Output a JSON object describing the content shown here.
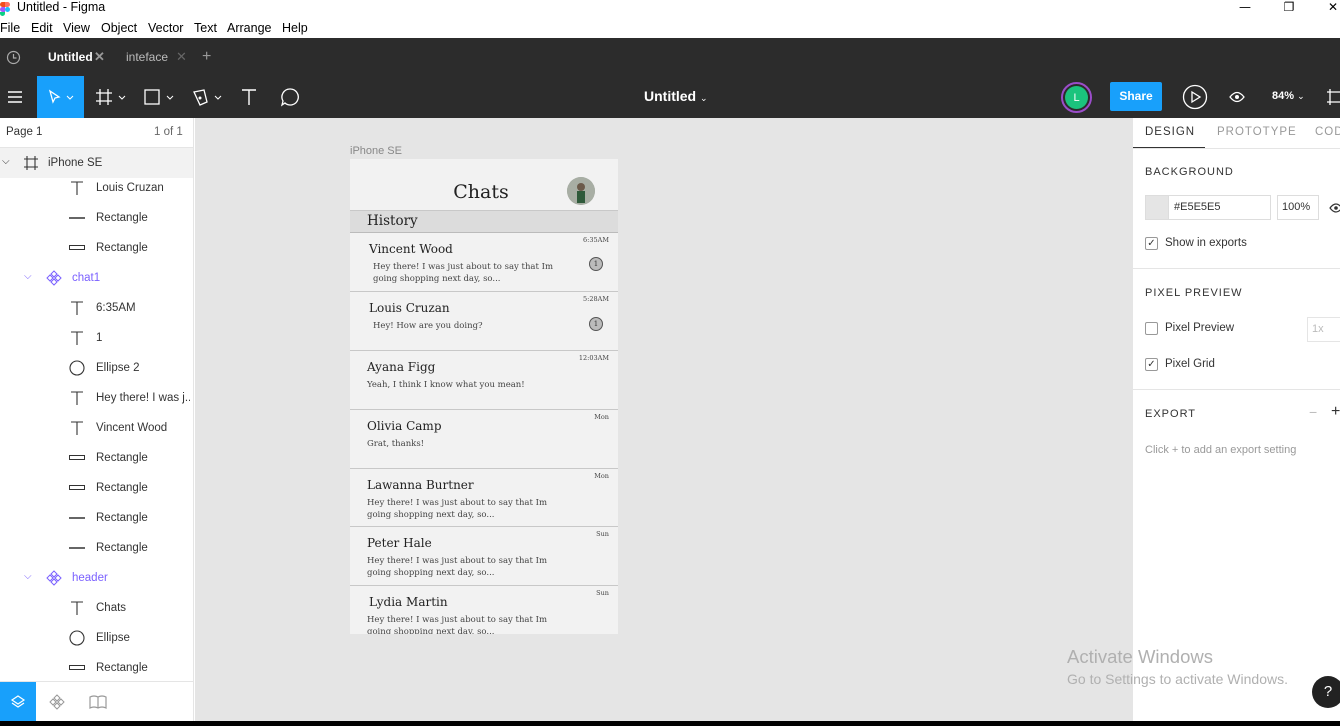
{
  "window": {
    "title": "Untitled - Figma",
    "minimize": "—",
    "restore": "❐",
    "close": "✕"
  },
  "menu": [
    "File",
    "Edit",
    "View",
    "Object",
    "Vector",
    "Text",
    "Arrange",
    "Help"
  ],
  "tabs": [
    {
      "label": "Untitled",
      "active": true
    },
    {
      "label": "inteface",
      "active": false
    }
  ],
  "toolbar": {
    "doc_name": "Untitled",
    "user_initial": "L",
    "share_label": "Share",
    "zoom": "84%"
  },
  "layers_panel": {
    "page": "Page 1",
    "page_count": "1 of 1",
    "items": [
      {
        "label": "iPhone SE",
        "type": "frame",
        "indent": 0
      },
      {
        "label": "Louis Cruzan",
        "type": "text",
        "indent": 2
      },
      {
        "label": "Rectangle",
        "type": "line",
        "indent": 2
      },
      {
        "label": "Rectangle",
        "type": "rect",
        "indent": 2
      },
      {
        "label": "chat1",
        "type": "component",
        "indent": 1
      },
      {
        "label": "6:35AM",
        "type": "text",
        "indent": 2
      },
      {
        "label": "1",
        "type": "text",
        "indent": 2
      },
      {
        "label": "Ellipse 2",
        "type": "ellipse",
        "indent": 2
      },
      {
        "label": "Hey there! I was j...",
        "type": "text",
        "indent": 2
      },
      {
        "label": "Vincent Wood",
        "type": "text",
        "indent": 2
      },
      {
        "label": "Rectangle",
        "type": "rect",
        "indent": 2
      },
      {
        "label": "Rectangle",
        "type": "rect",
        "indent": 2
      },
      {
        "label": "Rectangle",
        "type": "line",
        "indent": 2
      },
      {
        "label": "Rectangle",
        "type": "line",
        "indent": 2
      },
      {
        "label": "header",
        "type": "component",
        "indent": 1
      },
      {
        "label": "Chats",
        "type": "text",
        "indent": 2
      },
      {
        "label": "Ellipse",
        "type": "ellipse",
        "indent": 2
      },
      {
        "label": "Rectangle",
        "type": "rect",
        "indent": 2
      }
    ]
  },
  "canvas": {
    "frame_label": "iPhone SE",
    "header_title": "Chats",
    "section": "History",
    "chats": [
      {
        "name": "Vincent Wood",
        "message": "Hey there! I was just about to say that Im going shopping next day, so...",
        "time": "6:35AM",
        "badge": "1"
      },
      {
        "name": "Louis Cruzan",
        "message": "Hey! How are you doing?",
        "time": "5:28AM",
        "badge": "1"
      },
      {
        "name": "Ayana Figg",
        "message": "Yeah, I think I know what you mean!",
        "time": "12:03AM",
        "badge": ""
      },
      {
        "name": "Olivia Camp",
        "message": "Grat, thanks!",
        "time": "Mon",
        "badge": ""
      },
      {
        "name": "Lawanna Burtner",
        "message": "Hey there! I was just about to say that Im going shopping next day, so...",
        "time": "Mon",
        "badge": ""
      },
      {
        "name": "Peter Hale",
        "message": "Hey there! I was just about to say that Im going shopping next day, so...",
        "time": "Sun",
        "badge": ""
      },
      {
        "name": "Lydia Martin",
        "message": "Hey there! I was just about to say that Im going shopping next day, so...",
        "time": "Sun",
        "badge": ""
      }
    ]
  },
  "properties": {
    "tabs": [
      "DESIGN",
      "PROTOTYPE",
      "CODE"
    ],
    "background_title": "BACKGROUND",
    "background_hex": "#E5E5E5",
    "background_opacity": "100%",
    "show_in_exports": "Show in exports",
    "pixel_preview_title": "PIXEL PREVIEW",
    "pixel_preview": "Pixel Preview",
    "pixel_preview_scale": "1x",
    "pixel_grid": "Pixel Grid",
    "export_title": "EXPORT",
    "export_hint": "Click + to add an export setting"
  },
  "activation": {
    "line1": "Activate Windows",
    "line2": "Go to Settings to activate Windows."
  },
  "colors": {
    "accent": "#18a0fb",
    "component": "#7b61ff",
    "toolbar": "#2c2c2c",
    "canvas": "#e5e5e5"
  }
}
